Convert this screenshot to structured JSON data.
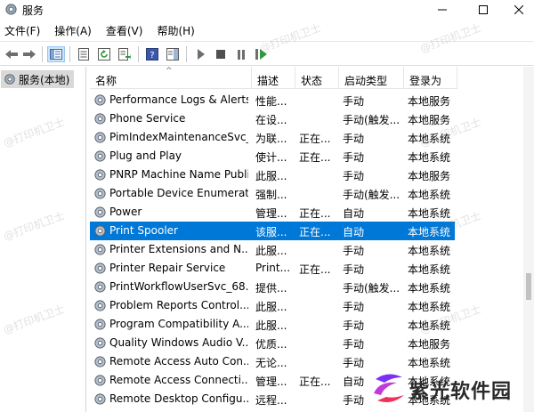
{
  "window": {
    "title": "服务"
  },
  "menu": [
    "文件(F)",
    "操作(A)",
    "查看(V)",
    "帮助(H)"
  ],
  "tree": {
    "root_label": "服务(本地)"
  },
  "columns": {
    "name": "名称",
    "desc": "描述",
    "status": "状态",
    "startup": "启动类型",
    "logon": "登录为"
  },
  "rows": [
    {
      "name": "Performance Logs & Alerts",
      "desc": "性能...",
      "status": "",
      "startup": "手动",
      "logon": "本地服务"
    },
    {
      "name": "Phone Service",
      "desc": "在设...",
      "status": "",
      "startup": "手动(触发...",
      "logon": "本地服务"
    },
    {
      "name": "PimIndexMaintenanceSvc_68...",
      "desc": "为联...",
      "status": "正在...",
      "startup": "手动",
      "logon": "本地系统"
    },
    {
      "name": "Plug and Play",
      "desc": "使计...",
      "status": "正在...",
      "startup": "手动",
      "logon": "本地系统"
    },
    {
      "name": "PNRP Machine Name Publi...",
      "desc": "此服...",
      "status": "",
      "startup": "手动",
      "logon": "本地服务"
    },
    {
      "name": "Portable Device Enumerator...",
      "desc": "强制...",
      "status": "",
      "startup": "手动(触发...",
      "logon": "本地系统"
    },
    {
      "name": "Power",
      "desc": "管理...",
      "status": "正在...",
      "startup": "自动",
      "logon": "本地系统"
    },
    {
      "name": "Print Spooler",
      "desc": "该服...",
      "status": "正在...",
      "startup": "自动",
      "logon": "本地系统"
    },
    {
      "name": "Printer Extensions and N...",
      "desc": "此服...",
      "status": "",
      "startup": "手动",
      "logon": "本地系统"
    },
    {
      "name": "Printer Repair Service",
      "desc": "Print...",
      "status": "正在...",
      "startup": "手动",
      "logon": "本地系统"
    },
    {
      "name": "PrintWorkflowUserSvc_68...",
      "desc": "提供...",
      "status": "",
      "startup": "手动(触发...",
      "logon": "本地系统"
    },
    {
      "name": "Problem Reports Control...",
      "desc": "此服...",
      "status": "",
      "startup": "手动",
      "logon": "本地系统"
    },
    {
      "name": "Program Compatibility A...",
      "desc": "此服...",
      "status": "",
      "startup": "手动",
      "logon": "本地系统"
    },
    {
      "name": "Quality Windows Audio V...",
      "desc": "优质...",
      "status": "",
      "startup": "手动",
      "logon": "本地服务"
    },
    {
      "name": "Remote Access Auto Con...",
      "desc": "无论...",
      "status": "",
      "startup": "手动",
      "logon": "本地系统"
    },
    {
      "name": "Remote Access Connecti...",
      "desc": "管理...",
      "status": "正在...",
      "startup": "自动",
      "logon": "本地系统"
    },
    {
      "name": "Remote Desktop Configu...",
      "desc": "远程...",
      "status": "",
      "startup": "手动",
      "logon": "本地系统"
    }
  ],
  "selected_row": "Print Spooler",
  "brand": {
    "name": "紫光软件园"
  },
  "watermark": "@打印机卫士",
  "colors": {
    "selection": "#0078d7",
    "tree_selected": "#d9d9d9",
    "brand_purple": "#7b2ff7",
    "brand_red": "#f0325a"
  }
}
